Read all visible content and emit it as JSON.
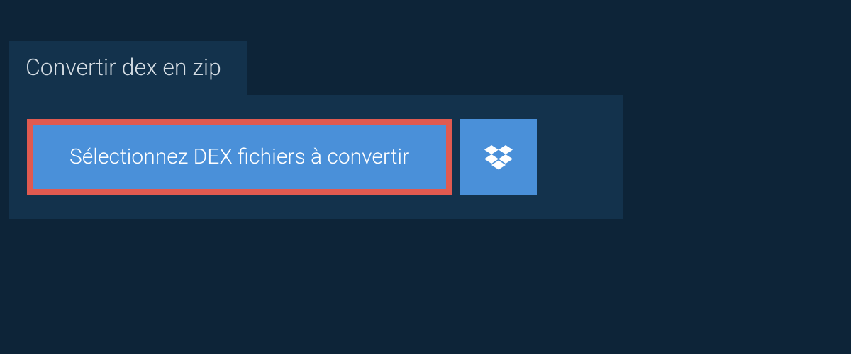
{
  "tab": {
    "title": "Convertir dex en zip"
  },
  "selectButton": {
    "label": "Sélectionnez DEX fichiers à convertir"
  },
  "icons": {
    "dropbox": "dropbox"
  },
  "colors": {
    "bgDark": "#0d2438",
    "panelBg": "#13324c",
    "buttonBlue": "#4a90d9",
    "highlightRed": "#e05a50"
  }
}
